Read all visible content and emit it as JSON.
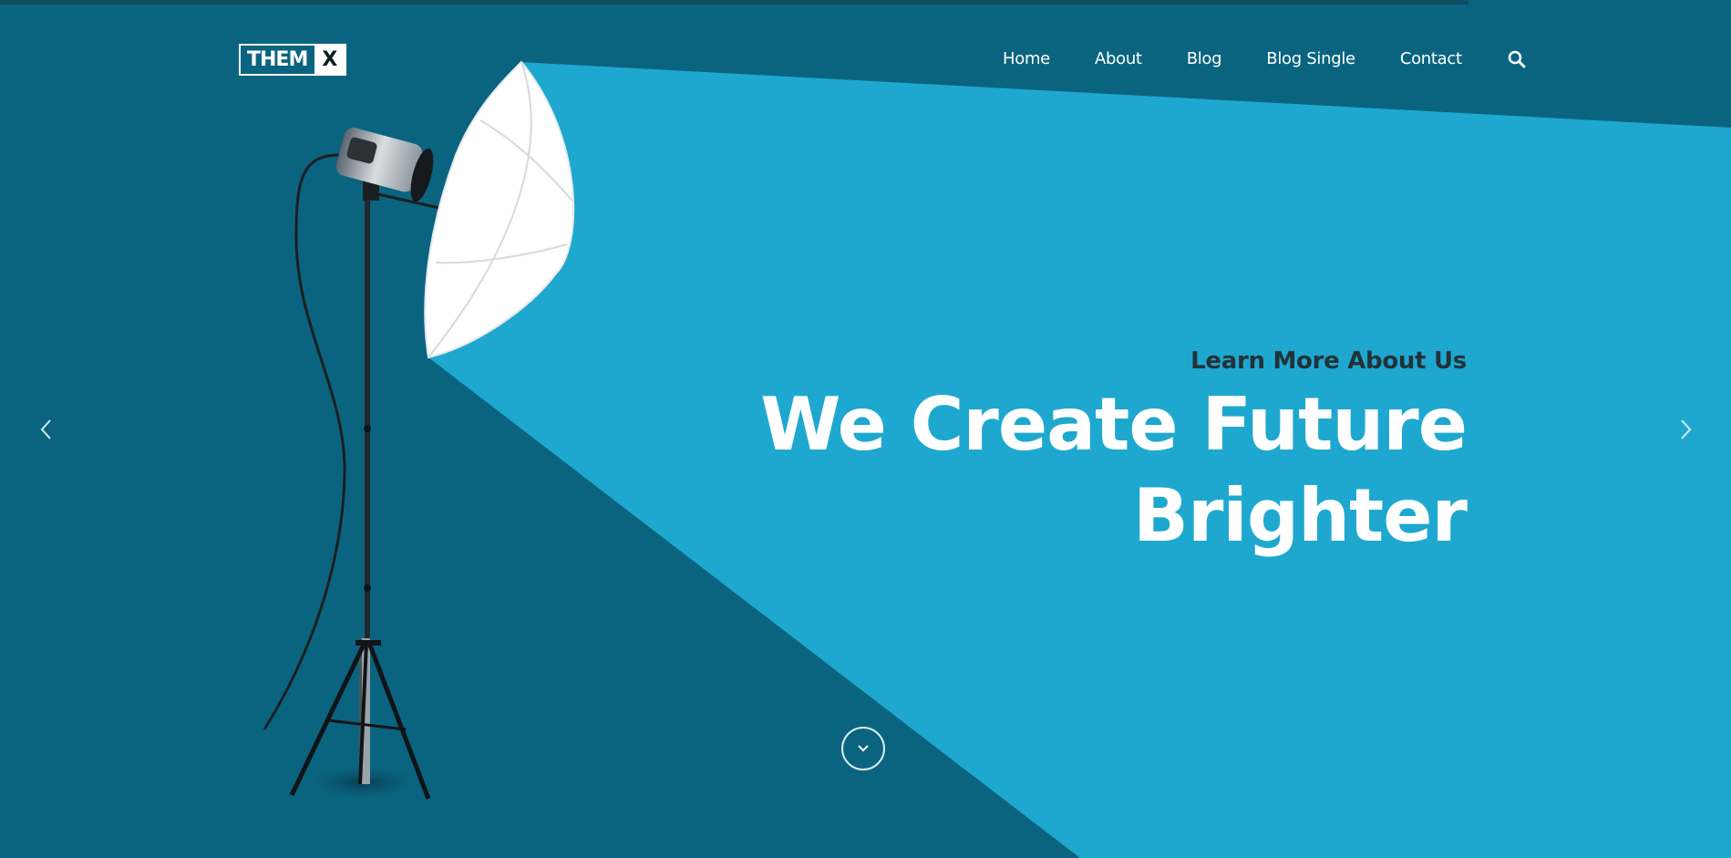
{
  "header": {
    "logo": {
      "part1": "THEM",
      "part2": "X"
    },
    "nav": {
      "items": [
        {
          "label": "Home"
        },
        {
          "label": "About"
        },
        {
          "label": "Blog"
        },
        {
          "label": "Blog Single"
        },
        {
          "label": "Contact"
        }
      ],
      "search_icon": "search-icon"
    }
  },
  "hero": {
    "eyebrow": "Learn More About Us",
    "headline_line1": "We Create Future",
    "headline_line2": "Brighter",
    "prev_icon": "chevron-left-icon",
    "next_icon": "chevron-right-icon",
    "scroll_icon": "chevron-down-icon"
  },
  "colors": {
    "background_dark": "#0a6480",
    "beam_light": "#1ea8cf",
    "headline_text": "#ffffff",
    "eyebrow_text": "#223238"
  }
}
